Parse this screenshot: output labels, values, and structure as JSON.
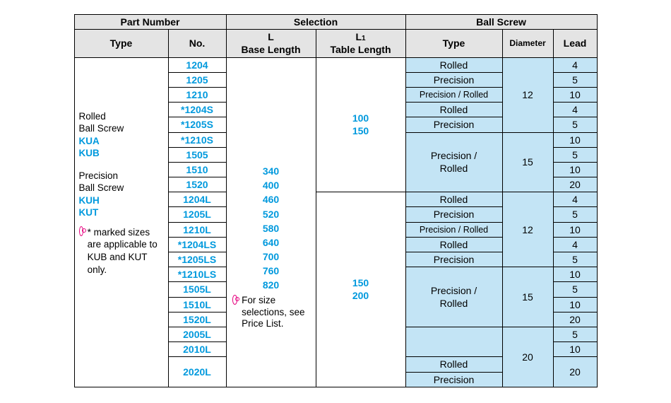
{
  "headers": {
    "part_number": "Part Number",
    "selection": "Selection",
    "ball_screw": "Ball Screw",
    "type": "Type",
    "no": "No.",
    "L_label": "L",
    "L_sub": "Base Length",
    "L1_label": "L",
    "L1_sub_num": "1",
    "L1_sub": "Table Length",
    "bs_type": "Type",
    "bs_diameter": "Diameter",
    "bs_lead": "Lead"
  },
  "type_block": {
    "rolled_title": "Rolled\nBall Screw",
    "rolled_code1": "KUA",
    "rolled_code2": "KUB",
    "precision_title": "Precision\nBall Screw",
    "precision_code1": "KUH",
    "precision_code2": "KUT",
    "footnote": "* marked sizes are applicable to KUB and KUT only."
  },
  "nos": [
    "1204",
    "1205",
    "1210",
    "*1204S",
    "*1205S",
    "*1210S",
    "1505",
    "1510",
    "1520",
    "1204L",
    "1205L",
    "1210L",
    "*1204LS",
    "*1205LS",
    "*1210LS",
    "1505L",
    "1510L",
    "1520L",
    "2005L",
    "2010L",
    "2020L"
  ],
  "L_values": [
    "340",
    "400",
    "460",
    "520",
    "580",
    "640",
    "700",
    "760",
    "820"
  ],
  "L_note": "For size selections, see Price List.",
  "L1_top": [
    "100",
    "150"
  ],
  "L1_bot": [
    "150",
    "200"
  ],
  "bs_types": {
    "r": "Rolled",
    "p": "Precision",
    "pr": "Precision / Rolled",
    "pr_split": "Precision /\nRolled"
  },
  "diameters": {
    "d12": "12",
    "d15": "15",
    "d20": "20"
  },
  "leads": {
    "l4": "4",
    "l5": "5",
    "l10": "10",
    "l20": "20"
  }
}
